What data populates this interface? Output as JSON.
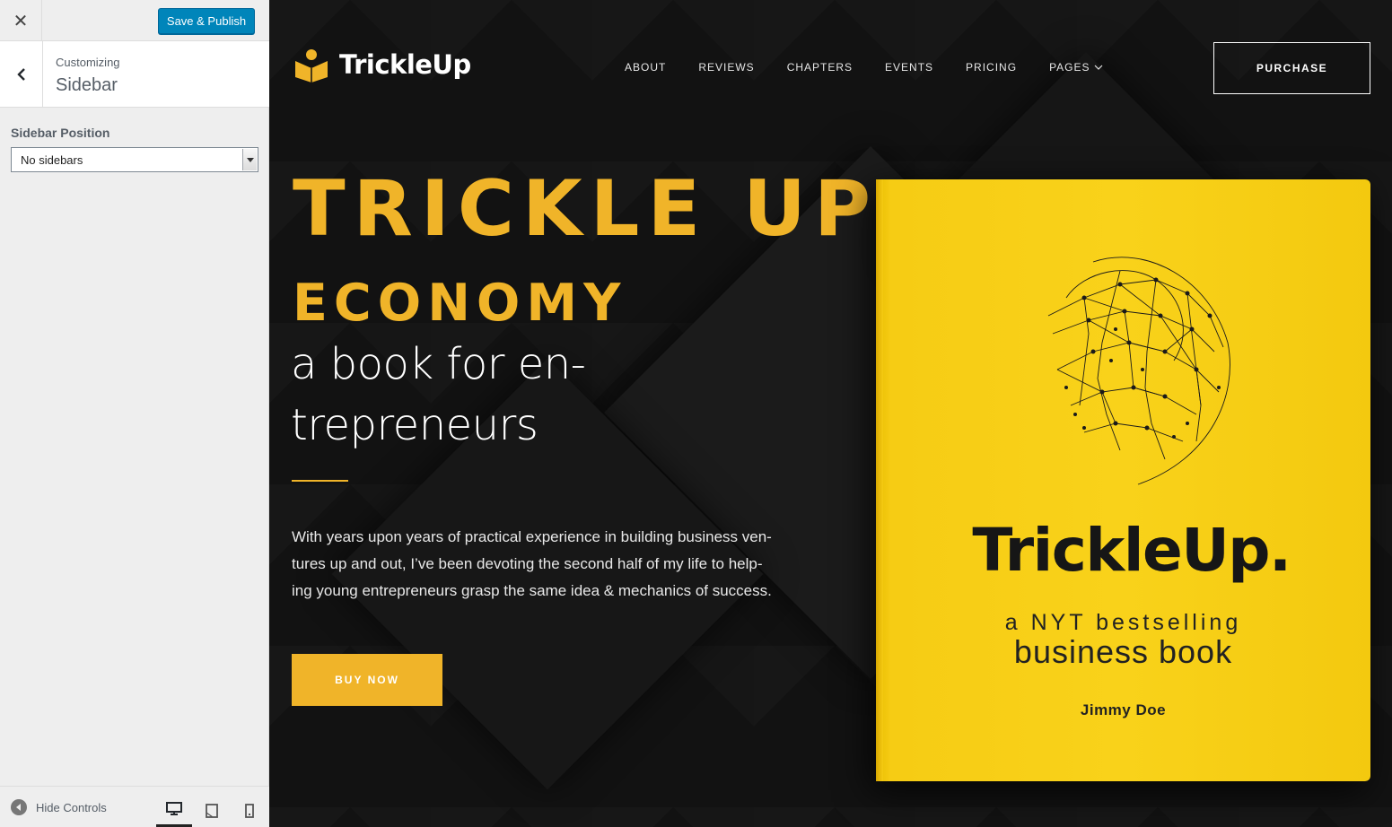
{
  "customizer": {
    "save_label": "Save & Publish",
    "breadcrumb": "Customizing",
    "section_title": "Sidebar",
    "control_label": "Sidebar Position",
    "select_value": "No sidebars",
    "hide_controls_label": "Hide Controls",
    "devices": [
      "desktop-icon",
      "tablet-icon",
      "mobile-icon"
    ],
    "accent_color": "#0085ba"
  },
  "site": {
    "logo_text": "TrickleUp",
    "nav": [
      {
        "label": "ABOUT"
      },
      {
        "label": "REVIEWS"
      },
      {
        "label": "CHAPTERS"
      },
      {
        "label": "EVENTS"
      },
      {
        "label": "PRICING"
      },
      {
        "label": "PAGES"
      }
    ],
    "purchase_label": "PURCHASE",
    "accent_color": "#f0b429"
  },
  "hero": {
    "title_line1": "TRICKLE UP",
    "title_line2": "ECONOMY",
    "subtitle_lines": [
      "a book for en-",
      "trepreneurs"
    ],
    "paragraph_lines": [
      "With years upon years of practical experience in building business ven-",
      "tures up and out, I’ve been devoting the second half of my life to help-",
      "ing young entrepreneurs grasp the same idea & mechanics of success."
    ],
    "buy_label": "BUY NOW"
  },
  "book": {
    "title": "TrickleUp.",
    "tagline1": "a NYT bestselling",
    "tagline2": "business book",
    "author": "Jimmy Doe",
    "cover_color": "#f9d21a"
  }
}
